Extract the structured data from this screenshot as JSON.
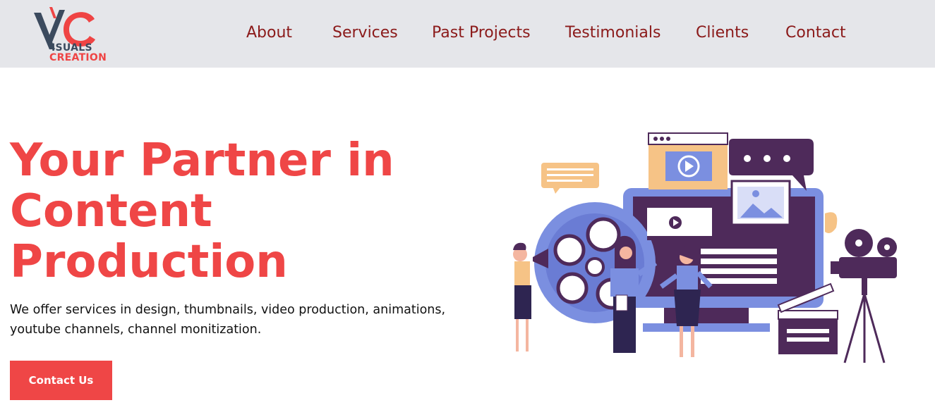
{
  "brand": {
    "logo_line1": "ISUALS",
    "logo_line2": "CREATION"
  },
  "nav": {
    "items": [
      {
        "label": "About"
      },
      {
        "label": "Services"
      },
      {
        "label": "Past Projects"
      },
      {
        "label": "Testimonials"
      },
      {
        "label": "Clients"
      },
      {
        "label": "Contact"
      }
    ]
  },
  "hero": {
    "title_lines": [
      "Your Partner in",
      "Content",
      "Production"
    ],
    "description_lines": [
      "We offer services in design, thumbnails, video production, animations,",
      "youtube channels, channel monitization."
    ],
    "cta_label": "Contact Us"
  },
  "colors": {
    "accent": "#ef4646",
    "nav_text": "#8b1a1a",
    "header_bg": "#e5e6ea",
    "illustration_purple": "#4e2a5a",
    "illustration_blue": "#7b8fe0",
    "illustration_peach": "#f6c386"
  },
  "icons": {
    "logo": "vc-logo-icon",
    "illustration": "video-production-team-illustration"
  }
}
